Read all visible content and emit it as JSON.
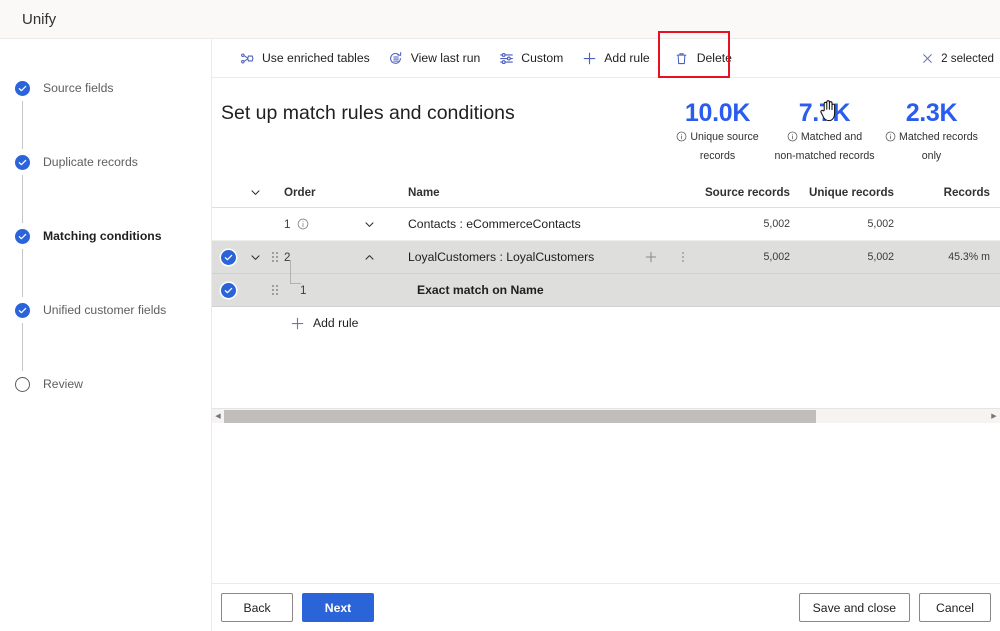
{
  "app": {
    "title": "Unify"
  },
  "wizard": {
    "steps": [
      {
        "label": "Source fields",
        "state": "done"
      },
      {
        "label": "Duplicate records",
        "state": "done"
      },
      {
        "label": "Matching conditions",
        "state": "current"
      },
      {
        "label": "Unified customer fields",
        "state": "done"
      },
      {
        "label": "Review",
        "state": "pending"
      }
    ]
  },
  "command_bar": {
    "items": [
      {
        "label": "Use enriched tables",
        "icon": "enriched-tables-icon"
      },
      {
        "label": "View last run",
        "icon": "history-icon"
      },
      {
        "label": "Custom",
        "icon": "sliders-icon"
      },
      {
        "label": "Add rule",
        "icon": "plus-icon"
      },
      {
        "label": "Delete",
        "icon": "trash-icon"
      }
    ],
    "selection_status": "2 selected",
    "selection_icon": "close-icon",
    "highlight_color": "#e81123"
  },
  "page": {
    "title": "Set up match rules and conditions"
  },
  "kpis": [
    {
      "value": "10.0K",
      "caption_line1": "Unique source",
      "caption_line2": "records"
    },
    {
      "value": "7.7K",
      "caption_line1": "Matched and",
      "caption_line2": "non-matched records"
    },
    {
      "value": "2.3K",
      "caption_line1": "Matched records",
      "caption_line2": "only"
    }
  ],
  "grid": {
    "columns": {
      "order": "Order",
      "name": "Name",
      "source_records": "Source records",
      "unique_records": "Unique records",
      "records": "Records"
    },
    "rows": [
      {
        "selected": false,
        "order": "1",
        "has_info": true,
        "expanded": false,
        "name": "Contacts : eCommerceContacts",
        "bold": false,
        "child": false,
        "source_records": "5,002",
        "unique_records": "5,002",
        "records": ""
      },
      {
        "selected": true,
        "order": "2",
        "has_info": false,
        "expanded": true,
        "name": "LoyalCustomers : LoyalCustomers",
        "bold": false,
        "child": false,
        "source_records": "5,002",
        "unique_records": "5,002",
        "records": "45.3% m"
      },
      {
        "selected": true,
        "order": "1",
        "has_info": false,
        "expanded": null,
        "name": "Exact match on Name",
        "bold": true,
        "child": true,
        "source_records": "",
        "unique_records": "",
        "records": ""
      }
    ],
    "add_rule_label": "Add rule"
  },
  "footer": {
    "back": "Back",
    "next": "Next",
    "save_and_close": "Save and close",
    "cancel": "Cancel"
  },
  "colors": {
    "accent_blue": "#2b63d9",
    "kpi_blue": "#2b5cf0",
    "highlight_red": "#e81123"
  }
}
